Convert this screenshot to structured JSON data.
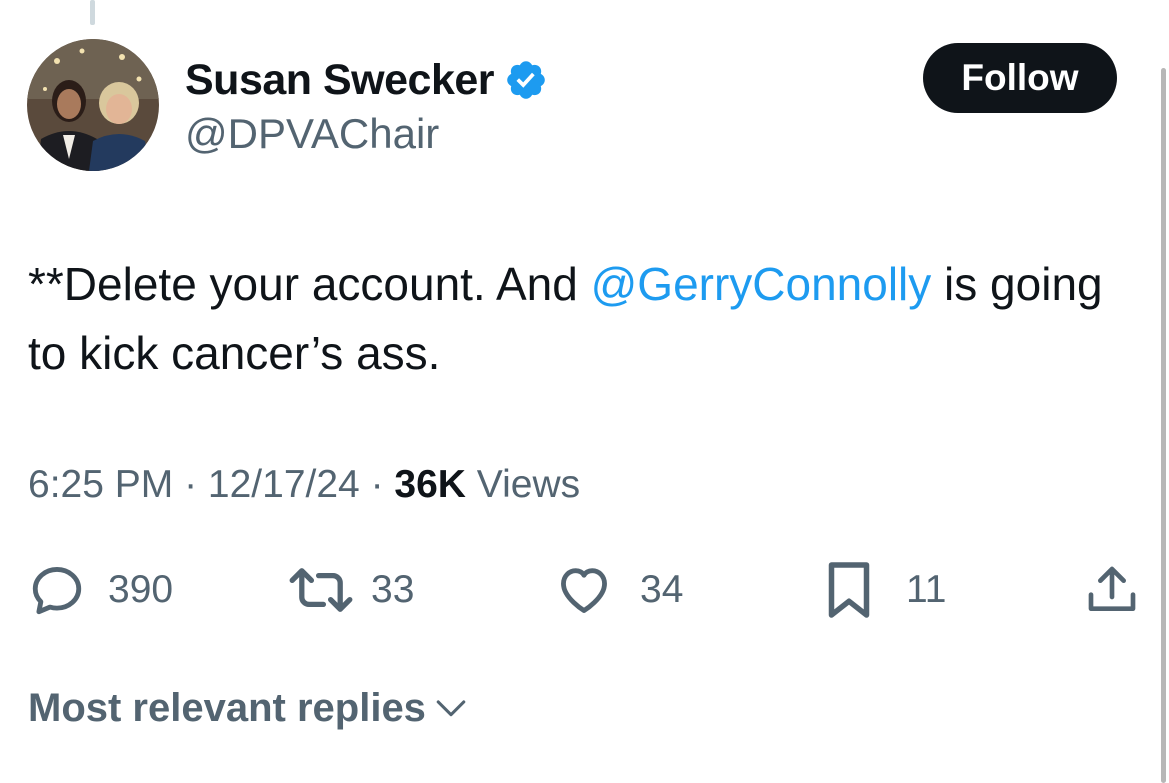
{
  "profile": {
    "display_name": "Susan Swecker",
    "handle": "@DPVAChair",
    "verified_icon": "verified-badge-icon",
    "avatar": "profile-photo"
  },
  "follow_button": {
    "label": "Follow"
  },
  "tweet": {
    "text_before": "**Delete your account. And ",
    "mention": "@GerryConnolly",
    "text_after": " is going to kick cancer’s ass."
  },
  "meta": {
    "time": "6:25 PM",
    "date": "12/17/24",
    "separator": " · ",
    "views_count": "36K",
    "views_label": "Views"
  },
  "actions": {
    "replies": {
      "icon": "reply-icon",
      "count": "390"
    },
    "retweets": {
      "icon": "retweet-icon",
      "count": "33"
    },
    "likes": {
      "icon": "heart-icon",
      "count": "34"
    },
    "bookmarks": {
      "icon": "bookmark-icon",
      "count": "11"
    },
    "share": {
      "icon": "share-icon"
    }
  },
  "replies_sort": {
    "label": "Most relevant replies",
    "icon": "chevron-down-icon"
  },
  "colors": {
    "text": "#0f1419",
    "secondary": "#536471",
    "accent": "#1d9bf0",
    "follow_bg": "#0f1419"
  }
}
